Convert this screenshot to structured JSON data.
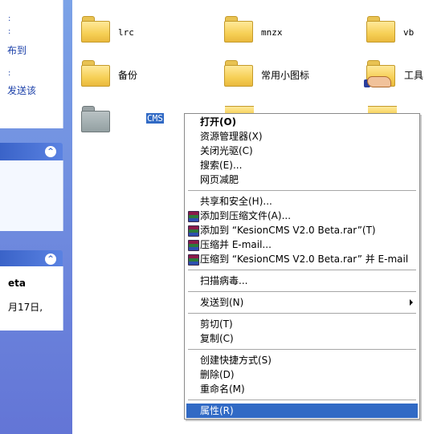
{
  "task_pane": {
    "frag_top": ":",
    "frag_pub": "布到",
    "frag_send": "发送该",
    "frag_title": "eta",
    "frag_date": "月17日,",
    "collapse_glyph": "^"
  },
  "files": [
    {
      "name": "lrc"
    },
    {
      "name": "mnzx"
    },
    {
      "name": "vb"
    },
    {
      "name": "备份"
    },
    {
      "name": "常用小图标"
    },
    {
      "name": "工具"
    },
    {
      "name": "CMS",
      "selected": true
    }
  ],
  "menu": {
    "open": "打开(O)",
    "explorer": "资源管理器(X)",
    "eject": "关闭光驱(C)",
    "search": "搜索(E)...",
    "weight_loss": "网页减肥",
    "sharing": "共享和安全(H)...",
    "add_archive": "添加到压缩文件(A)...",
    "add_to_rar": "添加到 “KesionCMS V2.0 Beta.rar”(T)",
    "compress_email": "压缩并 E-mail...",
    "compress_rar_email": "压缩到 “KesionCMS V2.0 Beta.rar” 并 E-mail",
    "scan": "扫描病毒...",
    "send_to": "发送到(N)",
    "cut": "剪切(T)",
    "copy": "复制(C)",
    "create_shortcut": "创建快捷方式(S)",
    "delete": "删除(D)",
    "rename": "重命名(M)",
    "properties": "属性(R)"
  },
  "colors": {
    "highlight": "#316ac5",
    "taskpane_blue": "#6a8ee0",
    "folder_yellow": "#f6cf55"
  }
}
